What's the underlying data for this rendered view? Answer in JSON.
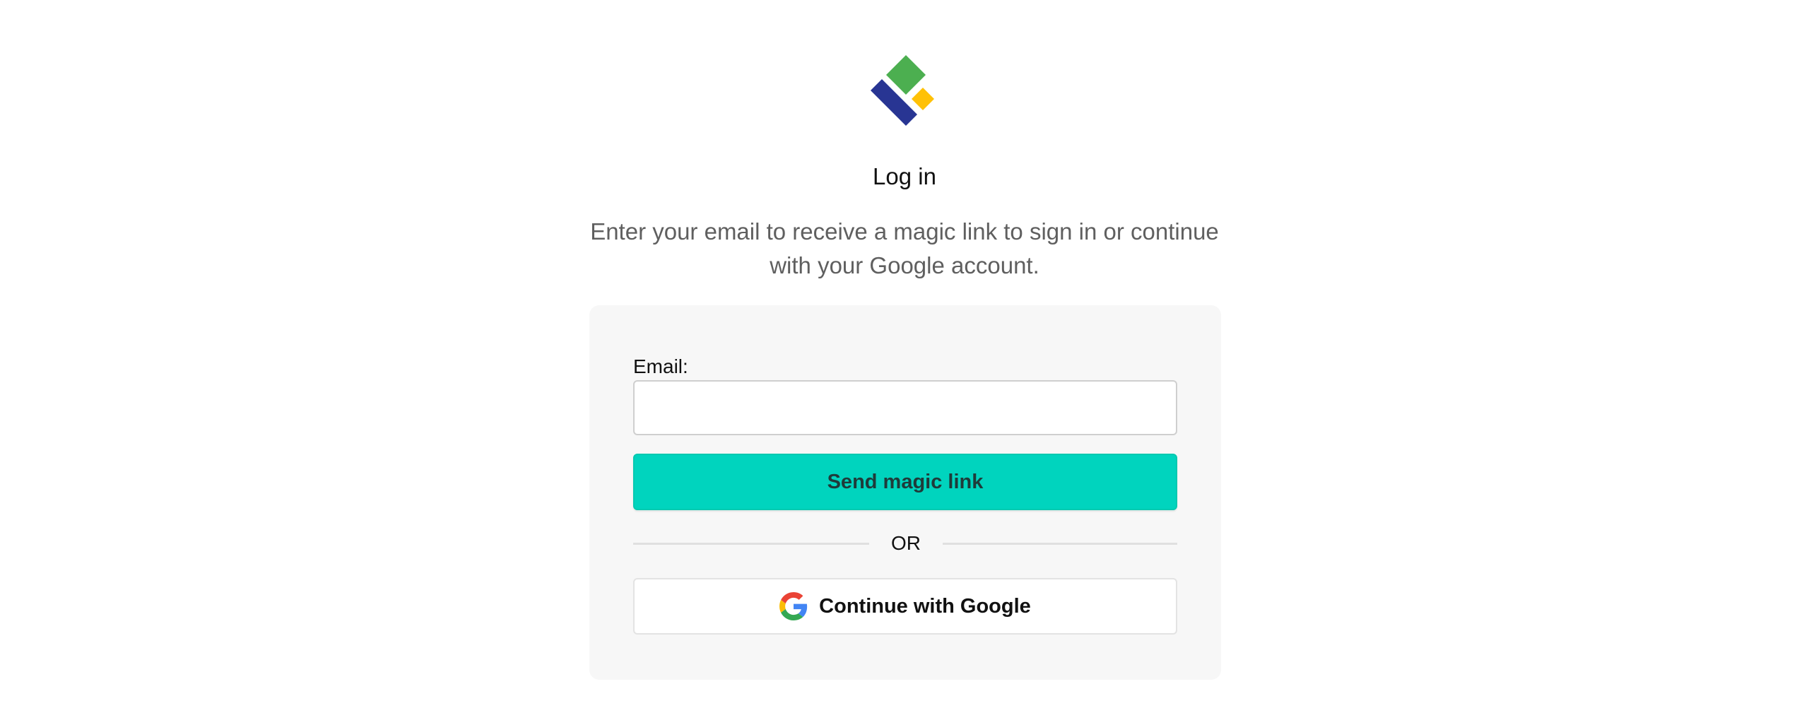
{
  "header": {
    "logo_icon": "diamond-logo-icon",
    "title": "Log in",
    "subtitle": "Enter your email to receive a magic link to sign in or continue with your Google account."
  },
  "form": {
    "email_label": "Email:",
    "email_value": "",
    "email_placeholder": "",
    "send_button_label": "Send magic link",
    "divider_text": "OR",
    "google_button_label": "Continue with Google",
    "google_icon": "google-icon"
  },
  "colors": {
    "accent": "#00d4be",
    "logo_green": "#4caf50",
    "logo_blue": "#283593",
    "logo_yellow": "#ffc107",
    "card_background": "#f7f7f7"
  }
}
